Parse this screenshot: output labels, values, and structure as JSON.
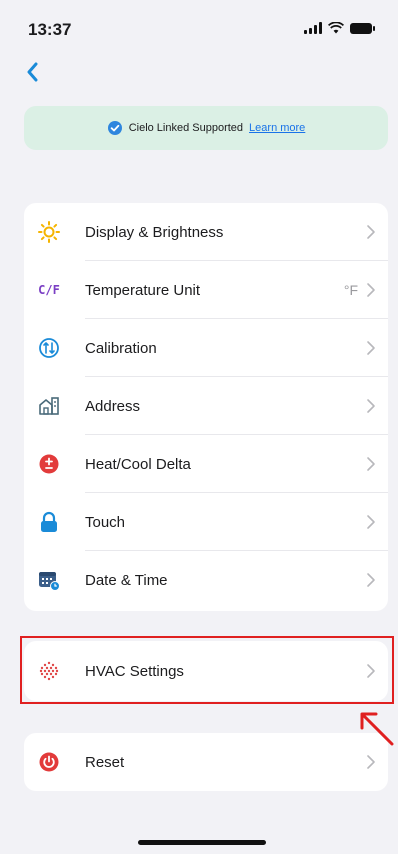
{
  "status_bar": {
    "time": "13:37"
  },
  "banner": {
    "text": "Cielo Linked Supported",
    "link": "Learn more"
  },
  "settings": [
    {
      "label": "Display & Brightness",
      "icon": "sun-icon"
    },
    {
      "label": "Temperature Unit",
      "icon": "cf-icon",
      "value": "°F",
      "icon_text": "C/F"
    },
    {
      "label": "Calibration",
      "icon": "calibration-icon"
    },
    {
      "label": "Address",
      "icon": "home-icon"
    },
    {
      "label": "Heat/Cool Delta",
      "icon": "plus-minus-icon"
    },
    {
      "label": "Touch",
      "icon": "lock-icon"
    },
    {
      "label": "Date & Time",
      "icon": "calendar-clock-icon"
    }
  ],
  "hvac": {
    "label": "HVAC Settings",
    "icon": "hvac-dots-icon"
  },
  "reset": {
    "label": "Reset",
    "icon": "power-icon"
  },
  "colors": {
    "accent": "#1a8bd8",
    "banner_bg": "#dbf0e5",
    "highlight": "#e02020"
  }
}
